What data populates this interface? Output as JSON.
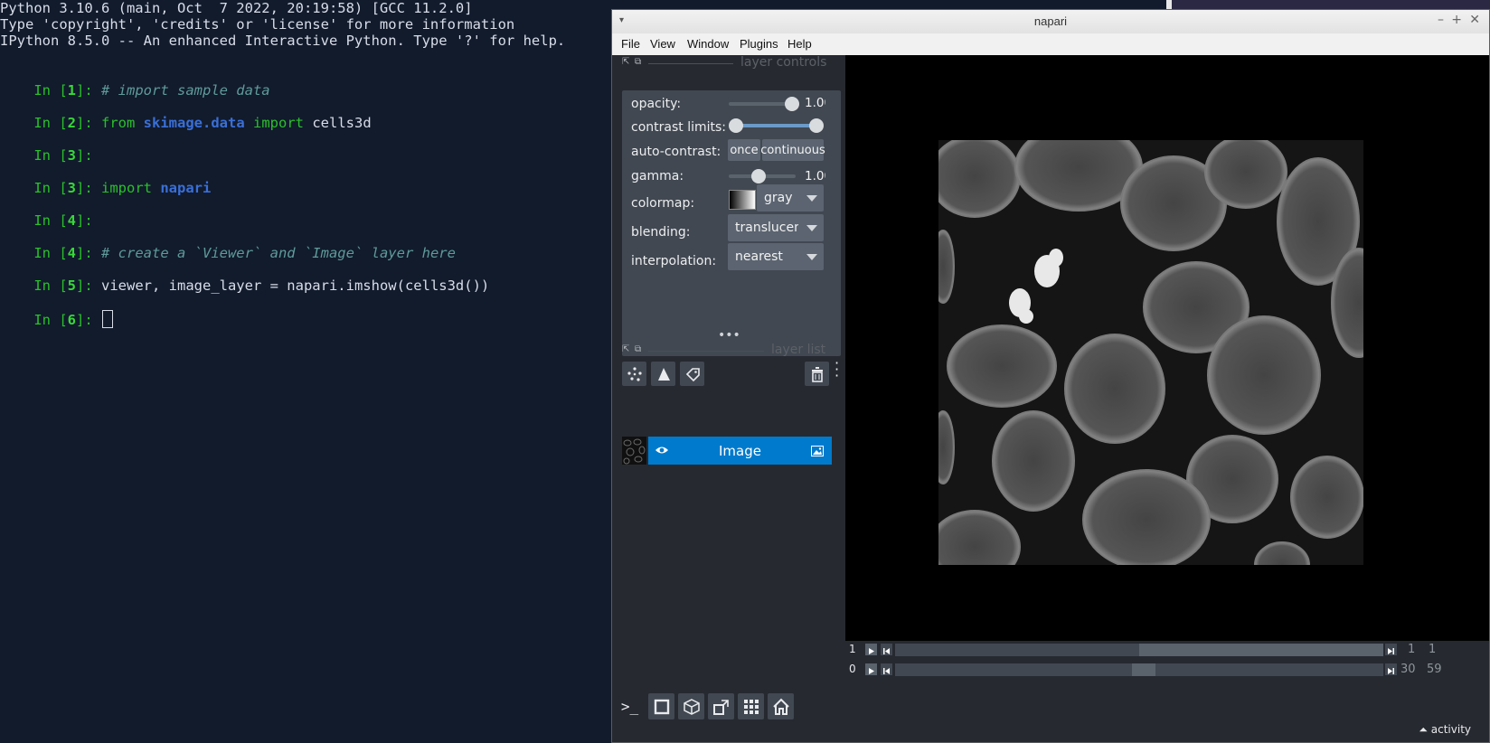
{
  "terminal": {
    "header1": "Python 3.10.6 (main, Oct  7 2022, 20:19:58) [GCC 11.2.0]",
    "header2": "Type 'copyright', 'credits' or 'license' for more information",
    "header3": "IPython 8.5.0 -- An enhanced Interactive Python. Type '?' for help.",
    "prompt_in": "In [",
    "prompt_close": "]: ",
    "lines": [
      {
        "num": "1",
        "parts": [
          {
            "t": "# import sample data"
          }
        ]
      },
      {
        "num": "2",
        "parts": [
          {
            "t": "from"
          },
          {
            "t": " "
          },
          {
            "t": "skimage.data"
          },
          {
            "t": " "
          },
          {
            "t": "import"
          },
          {
            "t": " cells3d"
          }
        ]
      },
      {
        "num": "3",
        "parts": []
      },
      {
        "num": "3",
        "parts": [
          {
            "t": "import"
          },
          {
            "t": " "
          },
          {
            "t": "napari"
          }
        ]
      },
      {
        "num": "4",
        "parts": []
      },
      {
        "num": "4",
        "parts": [
          {
            "t": "# create a `Viewer` and `Image` layer here"
          }
        ]
      },
      {
        "num": "5",
        "parts": [
          {
            "t": "viewer, image_layer = napari.imshow(cells3d())"
          }
        ]
      },
      {
        "num": "6",
        "parts": []
      }
    ]
  },
  "window": {
    "title": "napari",
    "menu": [
      "File",
      "View",
      "Window",
      "Plugins",
      "Help"
    ]
  },
  "layer_controls": {
    "title": "layer controls",
    "opacity_label": "opacity:",
    "opacity_value": "1.00",
    "opacity_level": 1.0,
    "contrast_label": "contrast limits:",
    "autocontrast_label": "auto-contrast:",
    "once_label": "once",
    "continuous_label": "continuous",
    "gamma_label": "gamma:",
    "gamma_value": "1.00",
    "gamma_level": 0.45,
    "colormap_label": "colormap:",
    "colormap_value": "gray",
    "blending_label": "blending:",
    "blending_value": "translucent",
    "interpolation_label": "interpolation:",
    "interpolation_value": "nearest"
  },
  "layer_list": {
    "title": "layer list",
    "layers": [
      {
        "name": "Image",
        "visible": true,
        "type": "image"
      }
    ]
  },
  "dims": [
    {
      "axis": "1",
      "current": "1",
      "max": "1",
      "position_fraction": 0.5
    },
    {
      "axis": "0",
      "current": "30",
      "max": "59",
      "position_fraction": 0.5
    }
  ],
  "status": {
    "activity_label": "activity"
  },
  "colors": {
    "accent": "#007acc",
    "panel": "#414851",
    "background": "#262930",
    "terminal_bg": "#111b2c"
  }
}
